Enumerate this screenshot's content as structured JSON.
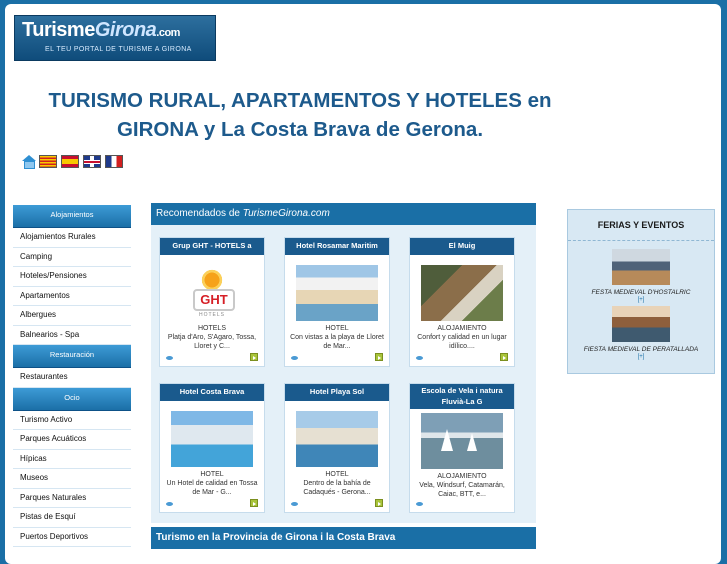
{
  "logo": {
    "part1": "Turisme",
    "part2": "Girona",
    "part3": ".com",
    "tagline": "EL TEU PORTAL DE TURISME A GIRONA"
  },
  "title": {
    "line1": "TURISMO RURAL, APARTAMENTOS Y HOTELES en",
    "line2": "GIRONA y La Costa Brava de Gerona."
  },
  "flags": [
    "home-icon",
    "catalan-flag",
    "spanish-flag",
    "uk-flag",
    "french-flag"
  ],
  "sidebar": {
    "sections": [
      {
        "heading": "Alojamientos",
        "items": [
          "Alojamientos Rurales",
          "Camping",
          "Hoteles/Pensiones",
          "Apartamentos",
          "Albergues",
          "Balnearios - Spa"
        ]
      },
      {
        "heading": "Restauración",
        "items": [
          "Restaurantes"
        ]
      },
      {
        "heading": "Ocio",
        "items": [
          "Turismo Activo",
          "Parques Acuáticos",
          "Hípicas",
          "Museos",
          "Parques Naturales",
          "Pistas de Esquí",
          "Puertos Deportivos"
        ]
      }
    ]
  },
  "recommended": {
    "heading_prefix": "Recomendados de ",
    "heading_site": "TurismeGirona.com",
    "cards": [
      {
        "title": "Grup GHT - HOTELS a",
        "category": "HOTELS",
        "desc": "Platja d'Aro, S'Agaro, Tossa, Lloret y C...",
        "image": "ght-logo"
      },
      {
        "title": "Hotel Rosamar Maritim",
        "category": "HOTEL",
        "desc": "Con vistas a la playa de Lloret de Mar...",
        "image": "beach-hotel"
      },
      {
        "title": "El Muig",
        "category": "ALOJAMIENTO",
        "desc": "Confort y calidad en un lugar idílico....",
        "image": "rural-house"
      },
      {
        "title": "Hotel Costa Brava",
        "category": "HOTEL",
        "desc": "Un Hotel de calidad en Tossa de Mar - G...",
        "image": "pool-hotel"
      },
      {
        "title": "Hotel Playa Sol",
        "category": "HOTEL",
        "desc": "Dentro de la bahía de Cadaqués - Gerona...",
        "image": "bay-hotel"
      },
      {
        "title": "Escola de Vela i natura Fluvià-La G",
        "category": "ALOJAMIENTO",
        "desc": "Vela, Windsurf, Catamarán, Caiac, BTT, e...",
        "image": "sailing"
      }
    ]
  },
  "bottom": {
    "heading": "Turismo en la Provincia de Girona i la Costa Brava"
  },
  "ferias": {
    "title": "FERIAS Y EVENTOS",
    "events": [
      {
        "label": "FESTA MEDIEVAL D'HOSTALRIC",
        "more": "[+]"
      },
      {
        "label": "FIESTA MEDIEVAL DE PERATALLADA",
        "more": "[+]"
      }
    ]
  },
  "colors": {
    "background": "#1a6fa6",
    "title": "#1d5a8c",
    "header": "#1a6fa6",
    "card_title": "#1a5a8d"
  }
}
